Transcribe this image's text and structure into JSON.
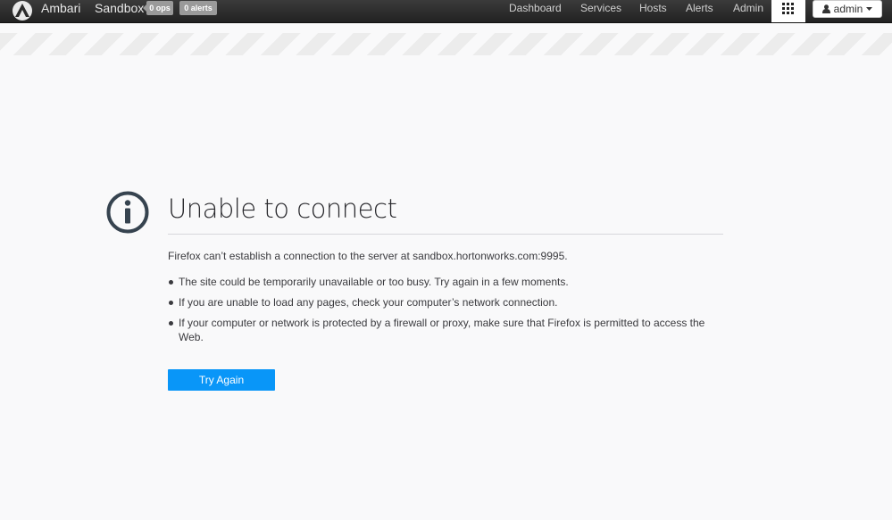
{
  "header": {
    "brand": "Ambari",
    "cluster_name": "Sandbox",
    "ops_badge": "0 ops",
    "alerts_badge": "0 alerts",
    "nav": [
      "Dashboard",
      "Services",
      "Hosts",
      "Alerts",
      "Admin"
    ],
    "user_label": "admin",
    "icons": {
      "logo": "ambari-logo-icon",
      "grid": "apps-grid-icon",
      "user": "user-icon",
      "caret": "caret-down-icon"
    }
  },
  "error_page": {
    "icon": "info-icon",
    "title": "Unable to connect",
    "description": "Firefox can’t establish a connection to the server at sandbox.hortonworks.com:9995.",
    "bullets": [
      "The site could be temporarily unavailable or too busy. Try again in a few moments.",
      "If you are unable to load any pages, check your computer’s network connection.",
      "If your computer or network is protected by a firewall or proxy, make sure that Firefox is permitted to access the Web."
    ],
    "button_label": "Try Again"
  },
  "colors": {
    "topbar": "#2b2b2b",
    "button_blue": "#0996f8",
    "icon_dark": "#2f3d4a"
  }
}
